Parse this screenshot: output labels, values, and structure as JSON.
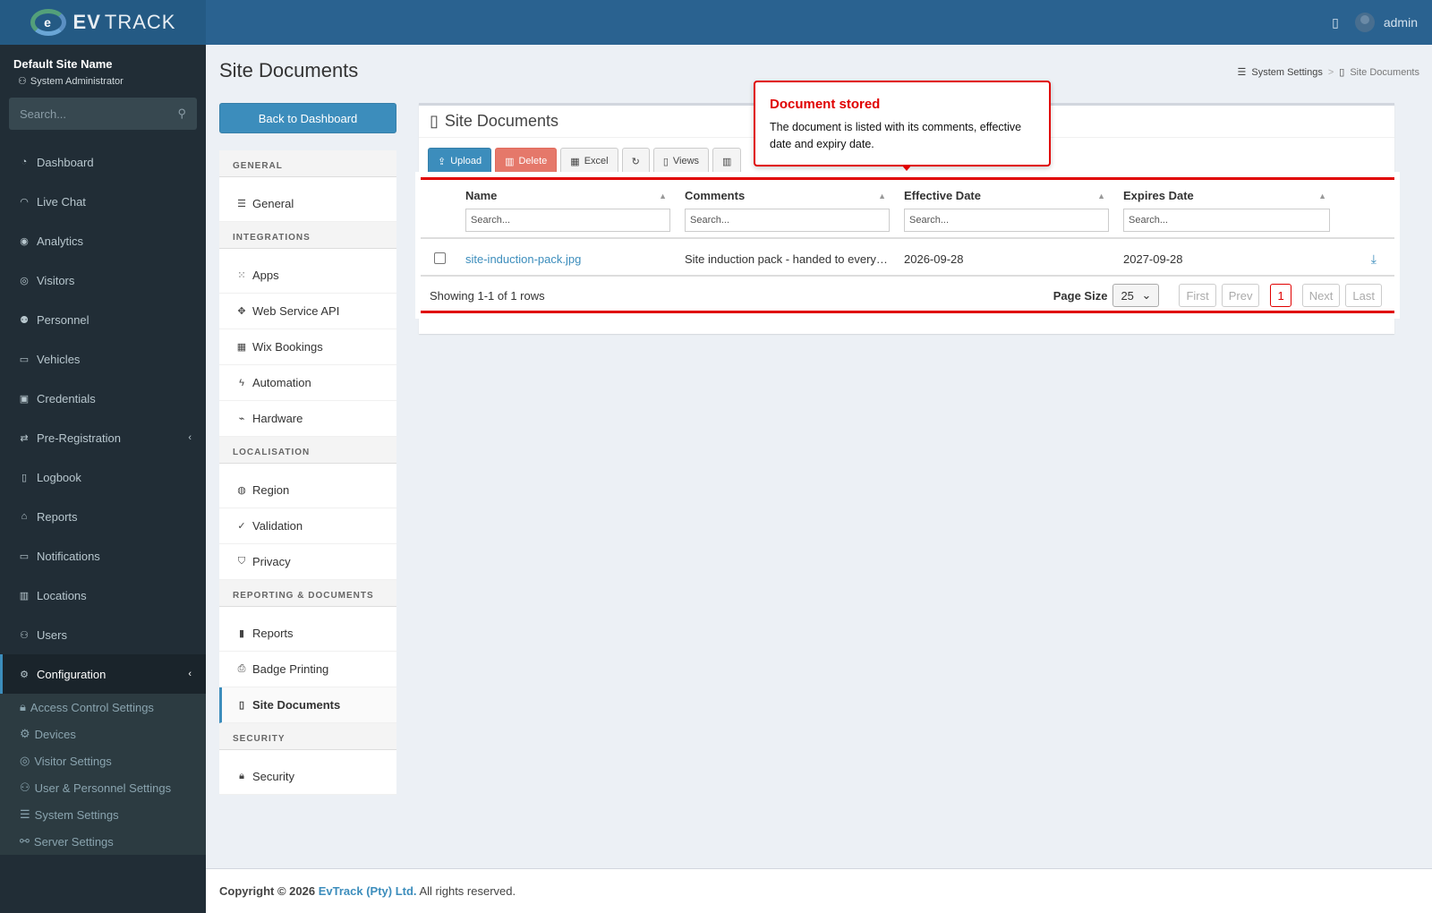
{
  "brand": {
    "logo_text_bold": "EV",
    "logo_text": "TRACK"
  },
  "header": {
    "user": "admin"
  },
  "sidebar": {
    "site_name": "Default Site Name",
    "role": "System Administrator",
    "search_placeholder": "Search...",
    "items": [
      {
        "label": "Dashboard",
        "icon": "dashboard-icon"
      },
      {
        "label": "Live Chat",
        "icon": "headset-icon"
      },
      {
        "label": "Analytics",
        "icon": "analytics-icon"
      },
      {
        "label": "Visitors",
        "icon": "eye-icon"
      },
      {
        "label": "Personnel",
        "icon": "person-icon"
      },
      {
        "label": "Vehicles",
        "icon": "car-icon"
      },
      {
        "label": "Credentials",
        "icon": "credentials-icon"
      },
      {
        "label": "Pre-Registration",
        "icon": "arrows-icon"
      },
      {
        "label": "Logbook",
        "icon": "book-icon"
      },
      {
        "label": "Reports",
        "icon": "chart-icon"
      },
      {
        "label": "Notifications",
        "icon": "chat-icon"
      },
      {
        "label": "Locations",
        "icon": "map-icon"
      },
      {
        "label": "Users",
        "icon": "users-icon"
      },
      {
        "label": "Configuration",
        "icon": "gear-icon"
      }
    ],
    "sub_items": [
      {
        "label": "Access Control Settings",
        "icon": "lock-icon"
      },
      {
        "label": "Devices",
        "icon": "cog-icon"
      },
      {
        "label": "Visitor Settings",
        "icon": "eye-icon"
      },
      {
        "label": "User & Personnel Settings",
        "icon": "users-icon"
      },
      {
        "label": "System Settings",
        "icon": "sliders-icon"
      },
      {
        "label": "Server Settings",
        "icon": "server-icon"
      }
    ]
  },
  "page": {
    "title": "Site Documents",
    "breadcrumb": [
      "System Settings",
      "Site Documents"
    ],
    "back_button": "Back to Dashboard"
  },
  "settings_nav": {
    "general_header": "GENERAL",
    "general": [
      {
        "label": "General"
      }
    ],
    "integrations_header": "INTEGRATIONS",
    "integrations": [
      {
        "label": "Apps"
      },
      {
        "label": "Web Service API"
      },
      {
        "label": "Wix Bookings"
      },
      {
        "label": "Automation"
      },
      {
        "label": "Hardware"
      }
    ],
    "localisation_header": "LOCALISATION",
    "localisation": [
      {
        "label": "Region"
      },
      {
        "label": "Validation"
      },
      {
        "label": "Privacy"
      }
    ],
    "reporting_header": "REPORTING & DOCUMENTS",
    "reporting": [
      {
        "label": "Reports"
      },
      {
        "label": "Badge Printing"
      },
      {
        "label": "Site Documents"
      }
    ],
    "security_header": "SECURITY",
    "security": [
      {
        "label": "Security"
      }
    ]
  },
  "box": {
    "title": "Site Documents",
    "toolbar": {
      "upload": "Upload",
      "delete": "Delete",
      "excel": "Excel",
      "views": "Views"
    }
  },
  "grid": {
    "columns": [
      "Name",
      "Comments",
      "Effective Date",
      "Expires Date"
    ],
    "search_placeholder": "Search...",
    "rows": [
      {
        "name": "site-induction-pack.jpg",
        "comments": "Site induction pack - handed to every…",
        "effective": "2026-09-28",
        "expires": "2027-09-28"
      }
    ],
    "showing": "Showing 1-1 of 1 rows",
    "page_size_label": "Page Size",
    "page_size": "25",
    "pager": {
      "first": "First",
      "prev": "Prev",
      "current": "1",
      "next": "Next",
      "last": "Last"
    }
  },
  "callout": {
    "title": "Document stored",
    "text": "The document is listed with its comments, effective date and expiry date."
  },
  "footer": {
    "copyright": "Copyright © 2026",
    "company": "EvTrack (Pty) Ltd.",
    "rights": "All rights reserved."
  },
  "colors": {
    "header": "#2a6290",
    "sidebar": "#212d36",
    "accent": "#3c8dbc",
    "highlight": "#e00000"
  }
}
